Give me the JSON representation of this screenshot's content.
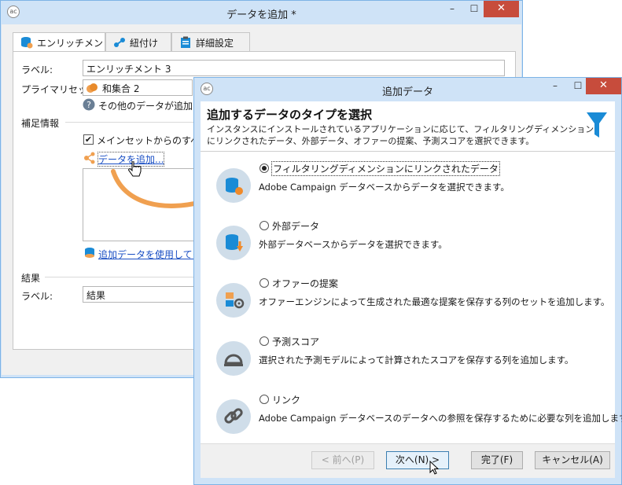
{
  "main_window": {
    "title": "データを追加 *",
    "tabs": [
      {
        "label": "エンリッチメント"
      },
      {
        "label": "紐付け"
      },
      {
        "label": "詳細設定"
      }
    ],
    "label_caption": "ラベル:",
    "label_value": "エンリッチメント 3",
    "primary_set_caption": "プライマリセット:",
    "primary_set_value": "和集合 2",
    "info_text": "その他のデータが追加され",
    "section_extra": "補足情報",
    "checkbox_label": "メインセットからのすべての追",
    "add_data_link": "データを追加...",
    "use_extra_data_link": "追加データを使用してター",
    "section_result": "結果",
    "result_label_caption": "ラベル:",
    "result_label_value": "結果"
  },
  "dialog": {
    "title": "追加データ",
    "heading": "追加するデータのタイプを選択",
    "description": "インスタンスにインストールされているアプリケーションに応じて、フィルタリングディメンションにリンクされたデータ、外部データ、オファーの提案、予測スコアを選択できます。",
    "options": [
      {
        "label": "フィルタリングディメンションにリンクされたデータ",
        "desc": "Adobe Campaign データベースからデータを選択できます。",
        "selected": true,
        "icon": "database-orange-icon"
      },
      {
        "label": "外部データ",
        "desc": "外部データベースからデータを選択できます。",
        "selected": false,
        "icon": "database-import-icon"
      },
      {
        "label": "オファーの提案",
        "desc": "オファーエンジンによって生成された最適な提案を保存する列のセットを追加します。",
        "selected": false,
        "icon": "offer-icon"
      },
      {
        "label": "予測スコア",
        "desc": "選択された予測モデルによって計算されたスコアを保存する列を追加します。",
        "selected": false,
        "icon": "score-icon"
      },
      {
        "label": "リンク",
        "desc": "Adobe Campaign データベースのデータへの参照を保存するために必要な列を追加します。",
        "selected": false,
        "icon": "chain-link-icon"
      }
    ],
    "buttons": {
      "back": "< 前へ(P)",
      "next": "次へ(N) >",
      "finish": "完了(F)",
      "cancel": "キャンセル(A)"
    }
  },
  "colors": {
    "frame": "#cfe3f7",
    "accent": "#1a8bd6",
    "arrow": "#f0a050",
    "close": "#c74c3c",
    "icon_bg": "#cfdde9"
  }
}
